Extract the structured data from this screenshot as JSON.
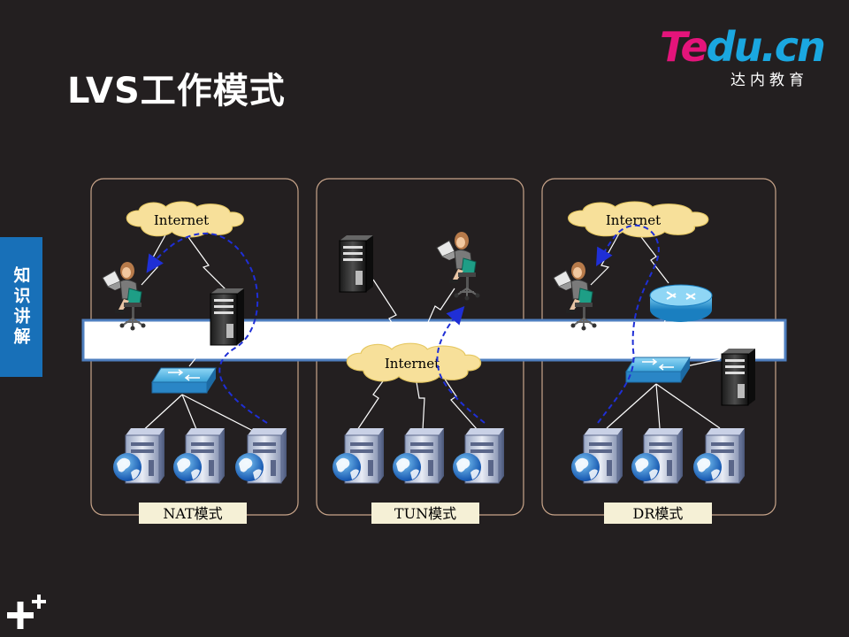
{
  "slide": {
    "title": "LVS工作模式",
    "side_tab": "知识讲解"
  },
  "logo": {
    "brand_part1": "Te",
    "brand_part2": "du.cn",
    "subtitle": "达内教育"
  },
  "panels": [
    {
      "label": "NAT模式",
      "cloud_label": "Internet"
    },
    {
      "label": "TUN模式",
      "cloud_label": "Internet"
    },
    {
      "label": "DR模式",
      "cloud_label": "Internet"
    }
  ],
  "colors": {
    "background": "#231f20",
    "panel_border": "#c9a58a",
    "cloud": "#f7e09a",
    "flow_arrow": "#1f2fd6",
    "band": "#ffffff",
    "band_border": "#4f7fbf",
    "side_tab": "#1870b8"
  }
}
